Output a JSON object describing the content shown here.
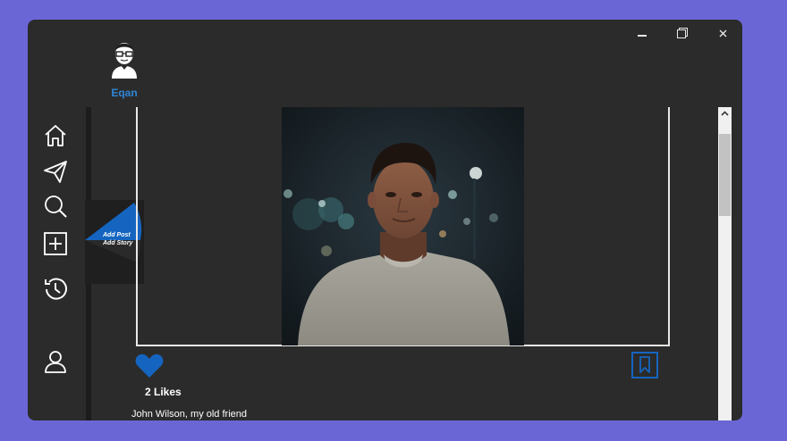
{
  "window": {
    "controls": [
      "minimize-icon",
      "restore-icon",
      "close-icon"
    ]
  },
  "profile": {
    "username": "Eqan",
    "avatar_icon": "user-avatar-icon"
  },
  "nav": {
    "items": [
      {
        "name": "home",
        "icon": "home-icon"
      },
      {
        "name": "send",
        "icon": "paper-plane-icon"
      },
      {
        "name": "search",
        "icon": "search-icon"
      },
      {
        "name": "add",
        "icon": "plus-square-icon"
      },
      {
        "name": "history",
        "icon": "history-icon"
      },
      {
        "name": "profile",
        "icon": "user-icon"
      }
    ]
  },
  "fan_menu": {
    "add_post_label": "Add Post",
    "add_story_label": "Add Story"
  },
  "post": {
    "likes_text": "2 Likes",
    "caption": "John Wilson, my old friend",
    "like_icon": "heart-icon",
    "bookmark_icon": "bookmark-icon"
  },
  "colors": {
    "accent": "#1565c0",
    "username": "#2e86d8",
    "window_bg": "#2b2b2b",
    "page_bg": "#6b66d6"
  }
}
